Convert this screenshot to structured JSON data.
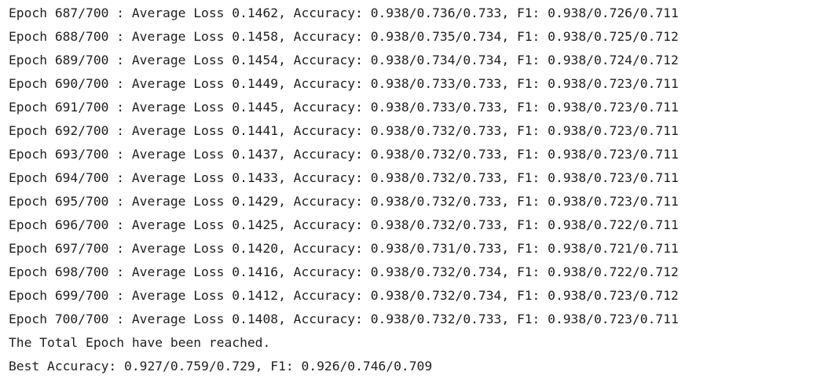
{
  "console": {
    "lines": [
      "Epoch 687/700 : Average Loss 0.1462, Accuracy: 0.938/0.736/0.733, F1: 0.938/0.726/0.711",
      "Epoch 688/700 : Average Loss 0.1458, Accuracy: 0.938/0.735/0.734, F1: 0.938/0.725/0.712",
      "Epoch 689/700 : Average Loss 0.1454, Accuracy: 0.938/0.734/0.734, F1: 0.938/0.724/0.712",
      "Epoch 690/700 : Average Loss 0.1449, Accuracy: 0.938/0.733/0.733, F1: 0.938/0.723/0.711",
      "Epoch 691/700 : Average Loss 0.1445, Accuracy: 0.938/0.733/0.733, F1: 0.938/0.723/0.711",
      "Epoch 692/700 : Average Loss 0.1441, Accuracy: 0.938/0.732/0.733, F1: 0.938/0.723/0.711",
      "Epoch 693/700 : Average Loss 0.1437, Accuracy: 0.938/0.732/0.733, F1: 0.938/0.723/0.711",
      "Epoch 694/700 : Average Loss 0.1433, Accuracy: 0.938/0.732/0.733, F1: 0.938/0.723/0.711",
      "Epoch 695/700 : Average Loss 0.1429, Accuracy: 0.938/0.732/0.733, F1: 0.938/0.723/0.711",
      "Epoch 696/700 : Average Loss 0.1425, Accuracy: 0.938/0.732/0.733, F1: 0.938/0.722/0.711",
      "Epoch 697/700 : Average Loss 0.1420, Accuracy: 0.938/0.731/0.733, F1: 0.938/0.721/0.711",
      "Epoch 698/700 : Average Loss 0.1416, Accuracy: 0.938/0.732/0.734, F1: 0.938/0.722/0.712",
      "Epoch 699/700 : Average Loss 0.1412, Accuracy: 0.938/0.732/0.734, F1: 0.938/0.723/0.712",
      "Epoch 700/700 : Average Loss 0.1408, Accuracy: 0.938/0.732/0.733, F1: 0.938/0.723/0.711",
      "The Total Epoch have been reached.",
      "Best Accuracy: 0.927/0.759/0.729, F1: 0.926/0.746/0.709"
    ]
  }
}
